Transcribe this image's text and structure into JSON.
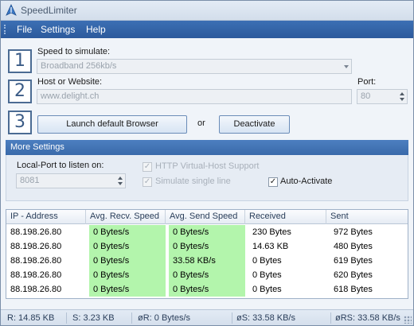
{
  "app": {
    "title": "SpeedLimiter"
  },
  "menu": {
    "file": "File",
    "settings": "Settings",
    "help": "Help"
  },
  "step1": {
    "number": "1",
    "label": "Speed to simulate:",
    "value": "Broadband 256kb/s"
  },
  "step2": {
    "number": "2",
    "host_label": "Host or Website:",
    "host_value": "www.delight.ch",
    "port_label": "Port:",
    "port_value": "80"
  },
  "step3": {
    "number": "3",
    "launch_button": "Launch default Browser",
    "or_text": "or",
    "deactivate_button": "Deactivate"
  },
  "more_settings": {
    "header": "More Settings",
    "local_port_label": "Local-Port to listen on:",
    "local_port_value": "8081",
    "http_vhost": {
      "label": "HTTP Virtual-Host Support",
      "checked": true,
      "enabled": false
    },
    "single_line": {
      "label": "Simulate single line",
      "checked": true,
      "enabled": false
    },
    "auto_activate": {
      "label": "Auto-Activate",
      "checked": true,
      "enabled": true
    }
  },
  "connections": {
    "columns": [
      "IP - Address",
      "Avg. Recv. Speed",
      "Avg. Send Speed",
      "Received",
      "Sent"
    ],
    "rows": [
      [
        "88.198.26.80",
        "0 Bytes/s",
        "0 Bytes/s",
        "230 Bytes",
        "972 Bytes"
      ],
      [
        "88.198.26.80",
        "0 Bytes/s",
        "0 Bytes/s",
        "14.63 KB",
        "480 Bytes"
      ],
      [
        "88.198.26.80",
        "0 Bytes/s",
        "33.58 KB/s",
        "0 Bytes",
        "619 Bytes"
      ],
      [
        "88.198.26.80",
        "0 Bytes/s",
        "0 Bytes/s",
        "0 Bytes",
        "620 Bytes"
      ],
      [
        "88.198.26.80",
        "0 Bytes/s",
        "0 Bytes/s",
        "0 Bytes",
        "618 Bytes"
      ]
    ],
    "highlight_color": "#b3f5ac"
  },
  "status": {
    "received": "R: 14.85 KB",
    "sent": "S: 3.23 KB",
    "avg_recv": "øR: 0 Bytes/s",
    "avg_send": "øS: 33.58 KB/s",
    "avg_rs": "øRS: 33.58 KB/s"
  },
  "colors": {
    "menubar": "#3c6fb4",
    "section_header": "#4d7fc0",
    "step_number": "#3a5b86"
  }
}
